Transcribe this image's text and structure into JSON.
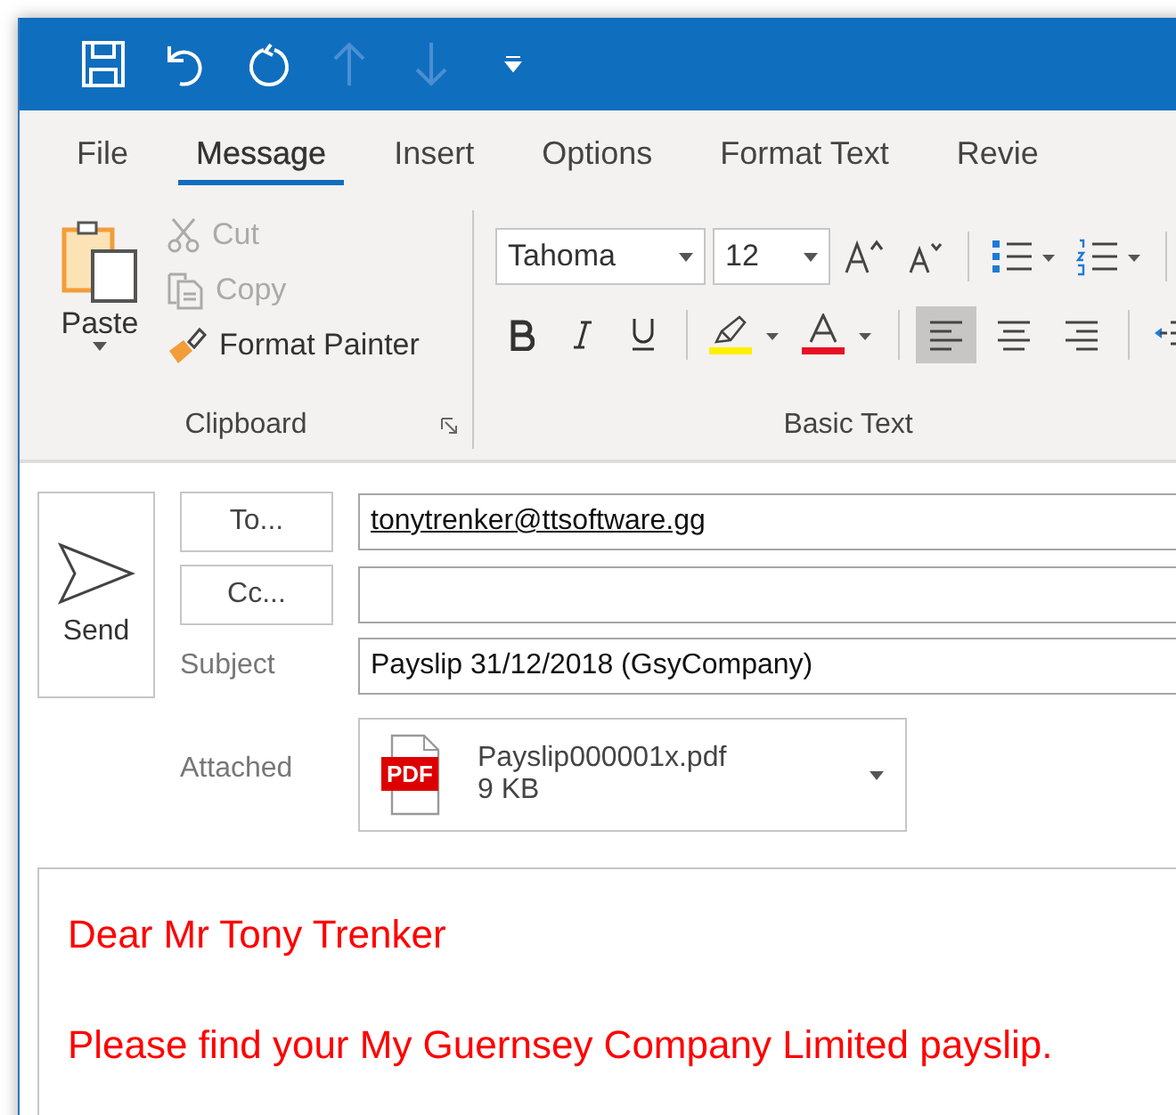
{
  "quick_access": [
    {
      "kind": "save",
      "disabled": false
    },
    {
      "kind": "undo",
      "disabled": false
    },
    {
      "kind": "redo",
      "disabled": false
    },
    {
      "kind": "up",
      "disabled": true
    },
    {
      "kind": "down",
      "disabled": true
    },
    {
      "kind": "customize",
      "disabled": false
    }
  ],
  "tabs": [
    {
      "label": "File",
      "selected": false
    },
    {
      "label": "Message",
      "selected": true
    },
    {
      "label": "Insert",
      "selected": false
    },
    {
      "label": "Options",
      "selected": false
    },
    {
      "label": "Format Text",
      "selected": false
    },
    {
      "label": "Revie",
      "selected": false
    }
  ],
  "clipboard": {
    "paste": "Paste",
    "items": [
      {
        "kind": "cut",
        "label": "Cut",
        "disabled": true
      },
      {
        "kind": "copy",
        "label": "Copy",
        "disabled": true
      },
      {
        "kind": "painter",
        "label": "Format Painter",
        "disabled": false
      }
    ],
    "label": "Clipboard"
  },
  "basic_text": {
    "font": "Tahoma",
    "size": "12",
    "label": "Basic Text",
    "alignment": [
      {
        "kind": "left",
        "selected": true
      },
      {
        "kind": "center",
        "selected": false
      },
      {
        "kind": "right",
        "selected": false
      }
    ]
  },
  "compose": {
    "send": "Send",
    "to_button": "To...",
    "to": "tonytrenker@ttsoftware.gg",
    "cc_button": "Cc...",
    "subject_label": "Subject",
    "subject": "Payslip 31/12/2018 (GsyCompany)",
    "attached_label": "Attached",
    "attachment": {
      "badge": "PDF",
      "name": "Payslip000001x.pdf",
      "size": "9 KB"
    }
  },
  "body": [
    "Dear Mr Tony Trenker",
    "Please find your My Guernsey Company Limited payslip."
  ]
}
